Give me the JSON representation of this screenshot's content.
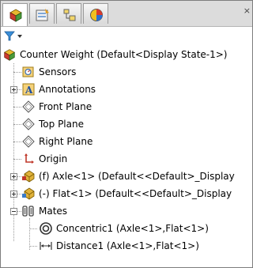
{
  "tabs": [
    {
      "name": "feature-manager",
      "active": true
    },
    {
      "name": "property-manager",
      "active": false
    },
    {
      "name": "configuration-manager",
      "active": false
    },
    {
      "name": "display-manager",
      "active": false
    }
  ],
  "close_label": "×",
  "filter": {
    "icon": "filter-icon"
  },
  "tree": {
    "root": "Counter Weight  (Default<Display State-1>)",
    "items": [
      {
        "label": "Sensors",
        "icon": "sensors-icon"
      },
      {
        "label": "Annotations",
        "icon": "annotations-icon",
        "expandable": true
      },
      {
        "label": "Front Plane",
        "icon": "plane-icon"
      },
      {
        "label": "Top Plane",
        "icon": "plane-icon"
      },
      {
        "label": "Right Plane",
        "icon": "plane-icon"
      },
      {
        "label": "Origin",
        "icon": "origin-icon"
      },
      {
        "label": "(f) Axle<1> (Default<<Default>_Display",
        "icon": "part-icon",
        "expandable": true
      },
      {
        "label": "(-) Flat<1> (Default<<Default>_Display",
        "icon": "part-icon",
        "expandable": true
      },
      {
        "label": "Mates",
        "icon": "mates-icon",
        "expanded": true
      },
      {
        "label": "Concentric1 (Axle<1>,Flat<1>)",
        "icon": "concentric-mate-icon"
      },
      {
        "label": "Distance1 (Axle<1>,Flat<1>)",
        "icon": "distance-mate-icon"
      }
    ]
  }
}
